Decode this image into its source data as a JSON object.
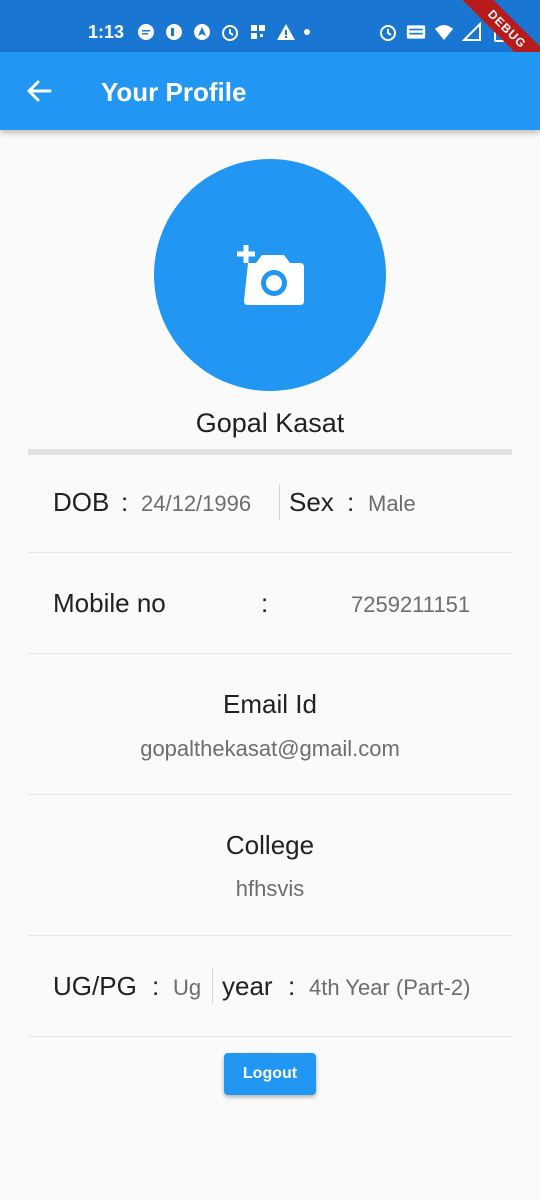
{
  "status_bar": {
    "time": "1:13",
    "debug_label": "DEBUG"
  },
  "appbar": {
    "title": "Your Profile",
    "back_icon": "arrow-back-icon"
  },
  "profile": {
    "avatar_icon": "add-a-photo-icon",
    "name": "Gopal Kasat"
  },
  "fields": {
    "dob_label": "DOB",
    "dob_sep": ":",
    "dob_value": "24/12/1996",
    "sex_label": "Sex",
    "sex_sep": ":",
    "sex_value": "Male",
    "mobile_label": "Mobile no",
    "mobile_sep": ":",
    "mobile_value": "7259211151",
    "email_label": "Email Id",
    "email_value": "gopalthekasat@gmail.com",
    "college_label": "College",
    "college_value": "hfhsvis",
    "ugpg_label": "UG/PG",
    "ugpg_sep": ":",
    "ugpg_value": "Ug",
    "year_label": "year",
    "year_sep": ":",
    "year_value": "4th Year (Part-2)"
  },
  "logout_label": "Logout",
  "colors": {
    "primary": "#2196f3",
    "status_bar": "#1976d2"
  }
}
